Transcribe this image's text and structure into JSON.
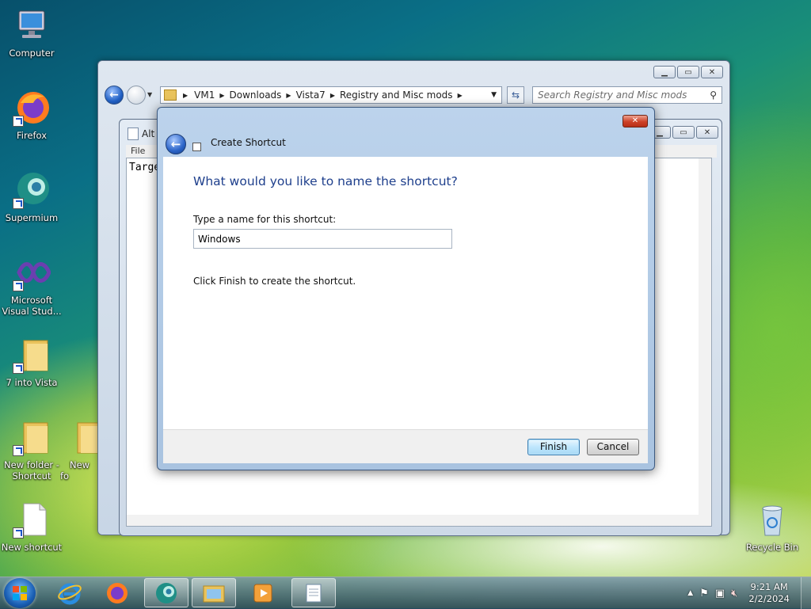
{
  "desktop": {
    "icons": [
      {
        "label": "Computer"
      },
      {
        "label": "Firefox"
      },
      {
        "label": "Supermium"
      },
      {
        "label": "Microsoft Visual Stud..."
      },
      {
        "label": "7 into Vista"
      },
      {
        "label": "New folder - Shortcut"
      },
      {
        "label": "New fo"
      },
      {
        "label": "New shortcut"
      },
      {
        "label": "Recycle Bin"
      }
    ]
  },
  "explorer": {
    "breadcrumb": [
      "VM1",
      "Downloads",
      "Vista7",
      "Registry and Misc mods"
    ],
    "search_placeholder": "Search Registry and Misc mods"
  },
  "notepad": {
    "title": "Alt",
    "menu_file": "File",
    "text": "Targe"
  },
  "dialog": {
    "title": "Create Shortcut",
    "heading": "What would you like to name the shortcut?",
    "name_label": "Type a name for this shortcut:",
    "name_value": "Windows",
    "hint": "Click Finish to create the shortcut.",
    "finish_label": "Finish",
    "cancel_label": "Cancel"
  },
  "taskbar": {
    "time": "9:21 AM",
    "date": "2/2/2024"
  }
}
